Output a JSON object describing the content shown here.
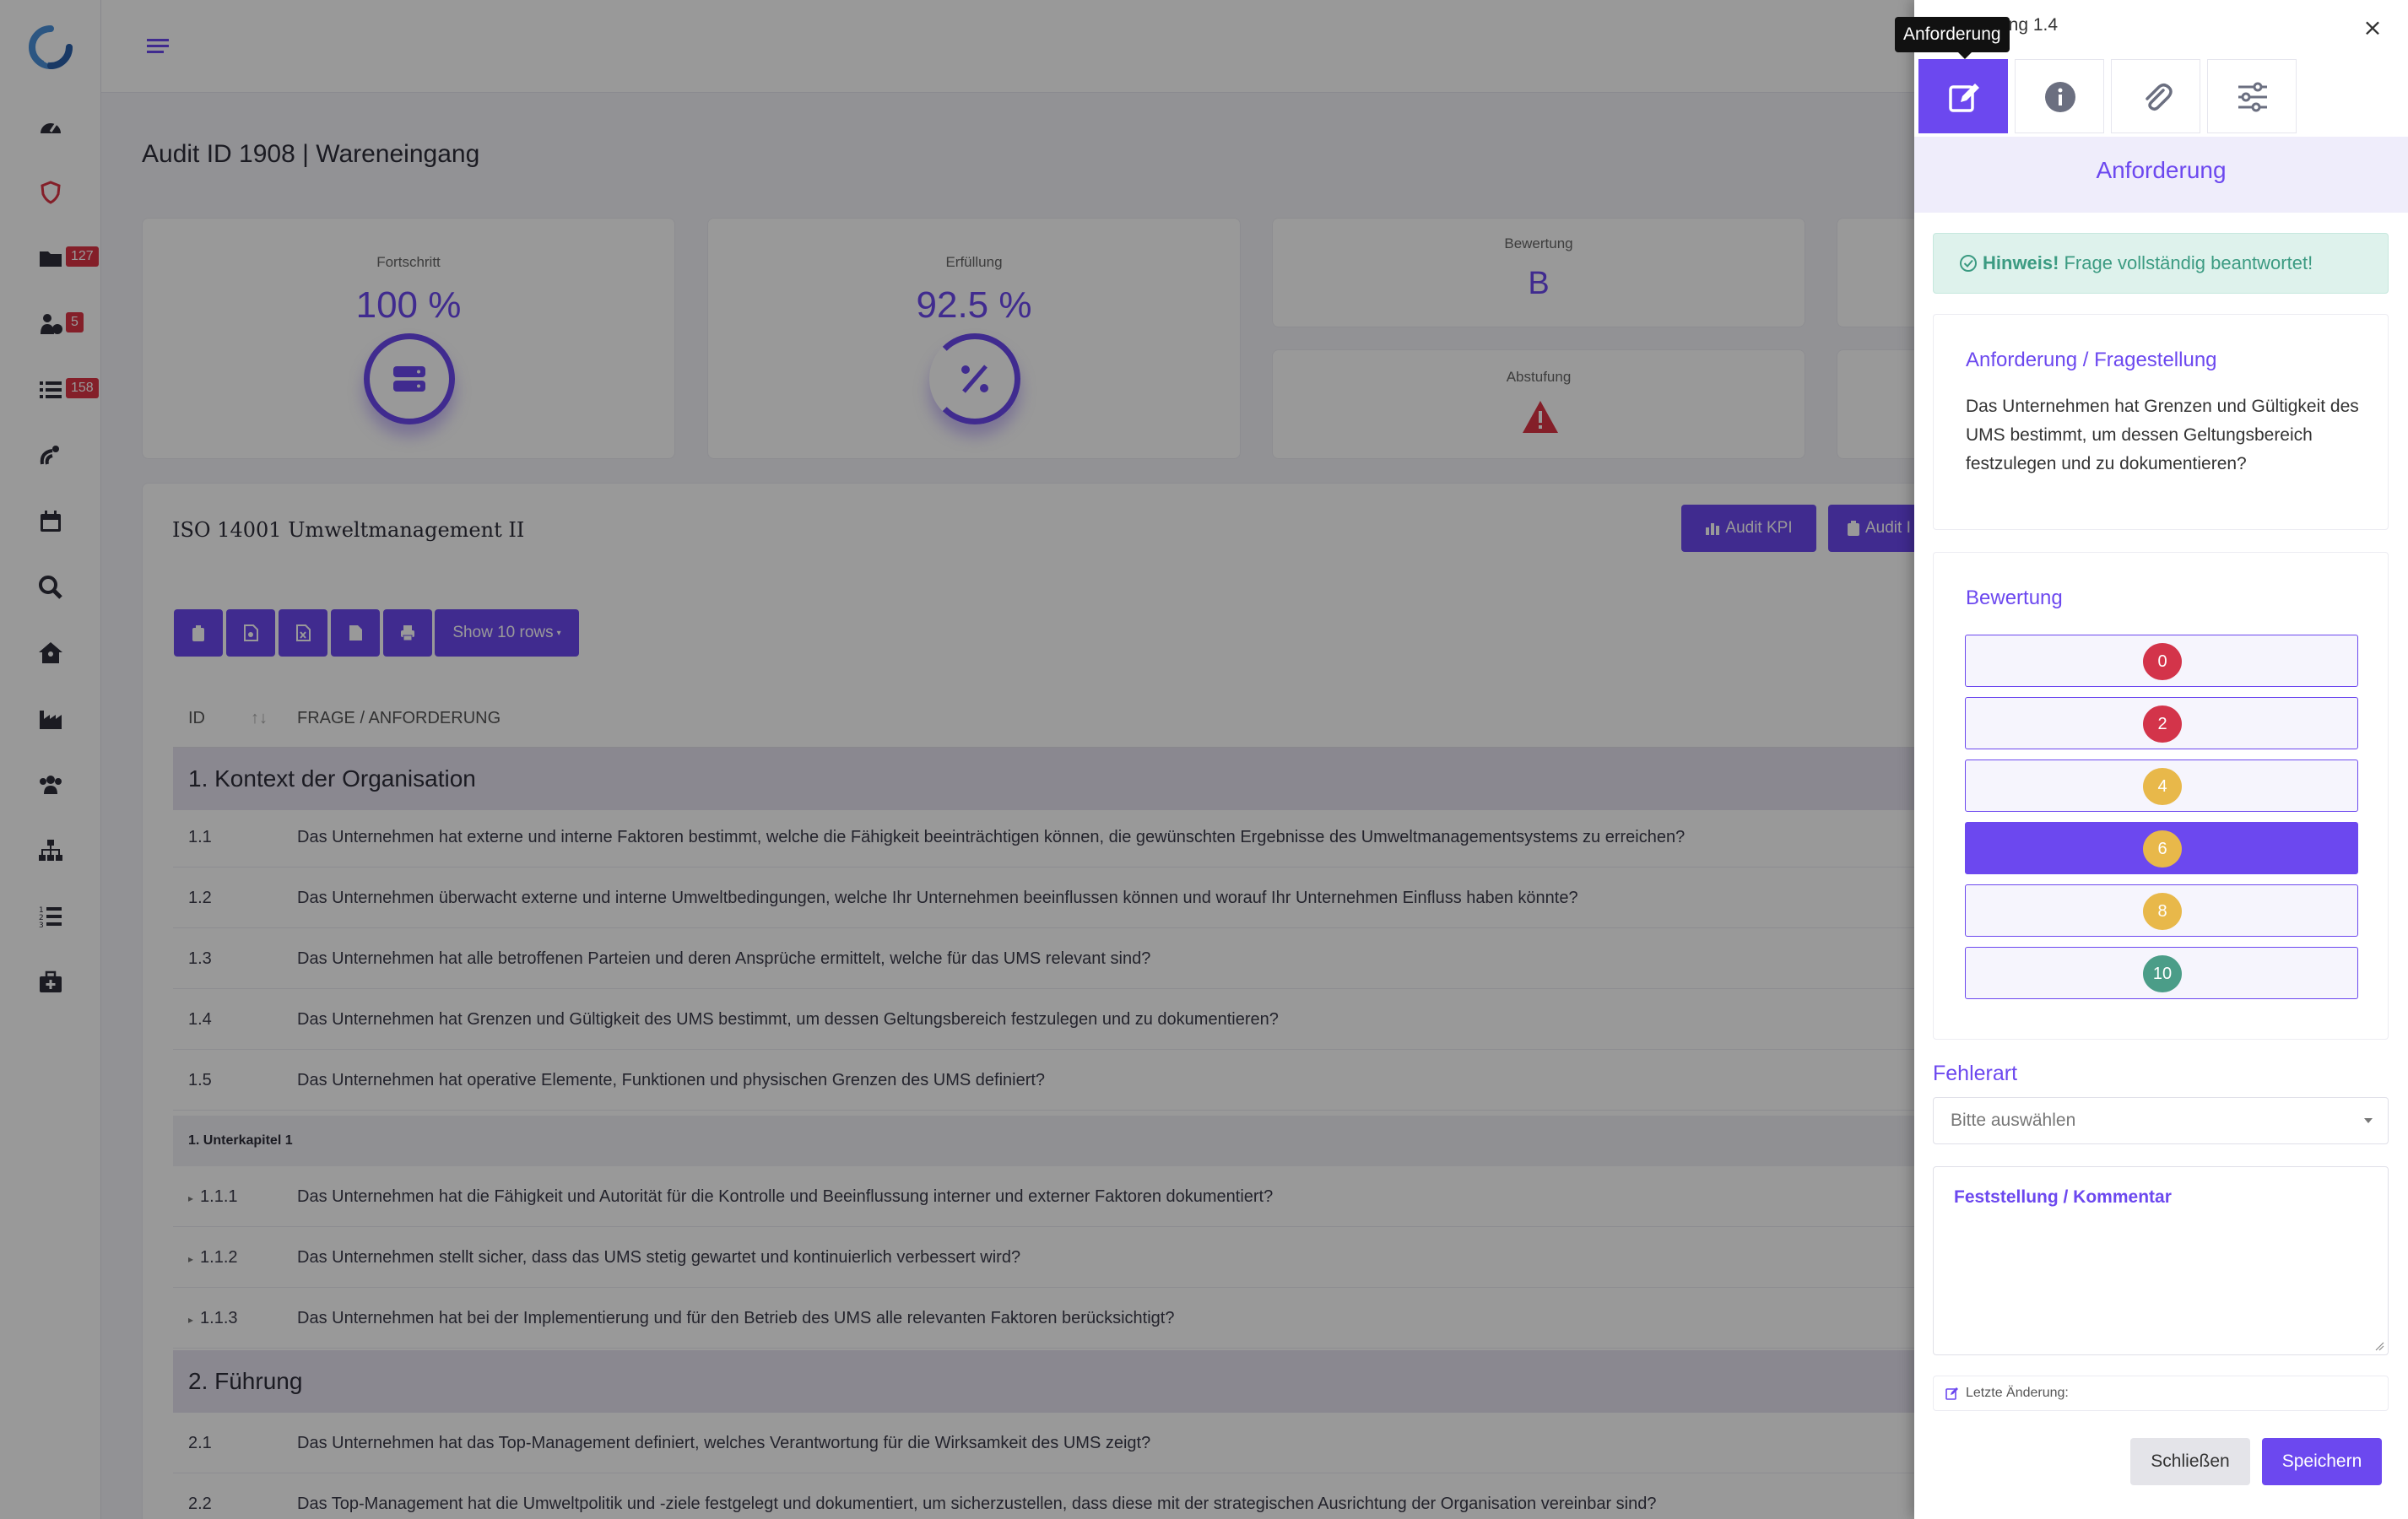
{
  "sidebar": {
    "items": [
      {
        "icon": "dashboard-gauge-icon",
        "badge": ""
      },
      {
        "icon": "shield-icon",
        "badge": ""
      },
      {
        "icon": "folder-icon",
        "badge": "127"
      },
      {
        "icon": "user-question-icon",
        "badge": "5"
      },
      {
        "icon": "list-icon",
        "badge": "158"
      },
      {
        "icon": "satellite-dish-icon",
        "badge": ""
      },
      {
        "icon": "calendar-icon",
        "badge": ""
      },
      {
        "icon": "search-zoom-icon",
        "badge": ""
      },
      {
        "icon": "house-user-icon",
        "badge": ""
      },
      {
        "icon": "industry-icon",
        "badge": ""
      },
      {
        "icon": "users-icon",
        "badge": ""
      },
      {
        "icon": "sitemap-icon",
        "badge": ""
      },
      {
        "icon": "ordered-list-icon",
        "badge": ""
      },
      {
        "icon": "first-aid-kit-icon",
        "badge": ""
      }
    ]
  },
  "main": {
    "title": "Audit ID 1908 | Wareneingang",
    "stats": {
      "progress_label": "Fortschritt",
      "progress_value": "100 %",
      "fulfillment_label": "Erfüllung",
      "fulfillment_value": "92.5 %",
      "rating_label": "Bewertung",
      "rating_value": "B",
      "downgrade_label": "Abstufung"
    },
    "table_title": "ISO 14001 Umweltmanagement II",
    "buttons": {
      "audit_kpi": "Audit KPI",
      "audit_second": "Audit I"
    },
    "show_rows": "Show 10 rows",
    "columns": {
      "id": "ID",
      "question": "FRAGE / ANFORDERUNG"
    },
    "sections": [
      {
        "title": "1. Kontext der Organisation"
      },
      {
        "title": "2. Führung"
      }
    ],
    "rows": [
      {
        "id": "1.1",
        "text": "Das Unternehmen hat externe und interne Faktoren bestimmt, welche die Fähigkeit beeinträchtigen können, die gewünschten Ergebnisse des Umweltmanagementsystems zu erreichen?"
      },
      {
        "id": "1.2",
        "text": "Das Unternehmen überwacht externe und interne Umweltbedingungen, welche Ihr Unternehmen beeinflussen können und worauf Ihr Unternehmen Einfluss haben könnte?"
      },
      {
        "id": "1.3",
        "text": "Das Unternehmen hat alle betroffenen Parteien und deren Ansprüche ermittelt, welche für das UMS relevant sind?"
      },
      {
        "id": "1.4",
        "text": "Das Unternehmen hat Grenzen und Gültigkeit des UMS bestimmt, um dessen Geltungsbereich festzulegen und zu dokumentieren?"
      },
      {
        "id": "1.5",
        "text": "Das Unternehmen hat operative Elemente, Funktionen und physischen Grenzen des UMS definiert?"
      }
    ],
    "subchapter": "1. Unterkapitel 1",
    "subrows": [
      {
        "id": "1.1.1",
        "text": "Das Unternehmen hat die Fähigkeit und Autorität für die Kontrolle und Beeinflussung interner und externer Faktoren dokumentiert?"
      },
      {
        "id": "1.1.2",
        "text": "Das Unternehmen stellt sicher, dass das UMS stetig gewartet und kontinuierlich verbessert wird?"
      },
      {
        "id": "1.1.3",
        "text": "Das Unternehmen hat bei der Implementierung und für den Betrieb des UMS alle relevanten Faktoren berücksichtigt?"
      }
    ],
    "rows2": [
      {
        "id": "2.1",
        "text": "Das Unternehmen hat das Top-Management definiert, welches Verantwortung für die Wirksamkeit des UMS zeigt?"
      },
      {
        "id": "2.2",
        "text": "Das Top-Management hat die Umweltpolitik und -ziele festgelegt und dokumentiert, um sicherzustellen, dass diese mit der strategischen Ausrichtung der Organisation vereinbar sind?"
      }
    ]
  },
  "drawer": {
    "title": "ung 1.4",
    "tooltip": "Anforderung",
    "tabs": [
      "edit-icon",
      "info-icon",
      "paperclip-icon",
      "sliders-icon"
    ],
    "header": "Anforderung",
    "hint_strong": "Hinweis!",
    "hint_text": "Frage vollständig beantwortet!",
    "req_title": "Anforderung / Fragestellung",
    "req_text": "Das Unternehmen hat Grenzen und Gültigkeit des UMS bestimmt, um dessen Geltungsbereich festzulegen und zu dokumentieren?",
    "rating_title": "Bewertung",
    "scores": [
      {
        "value": "0",
        "color": "#d3344a"
      },
      {
        "value": "2",
        "color": "#d3344a"
      },
      {
        "value": "4",
        "color": "#e8b84a"
      },
      {
        "value": "6",
        "color": "#e8b84a"
      },
      {
        "value": "8",
        "color": "#e8b84a"
      },
      {
        "value": "10",
        "color": "#4b9d88"
      }
    ],
    "selected_score": "6",
    "fehlerart_label": "Fehlerart",
    "fehlerart_placeholder": "Bitte auswählen",
    "comment_label": "Feststellung / Kommentar",
    "last_change": "Letzte Änderung:",
    "cancel": "Schließen",
    "save": "Speichern"
  },
  "colors": {
    "accent": "#6c48ef",
    "danger": "#dc3545"
  }
}
